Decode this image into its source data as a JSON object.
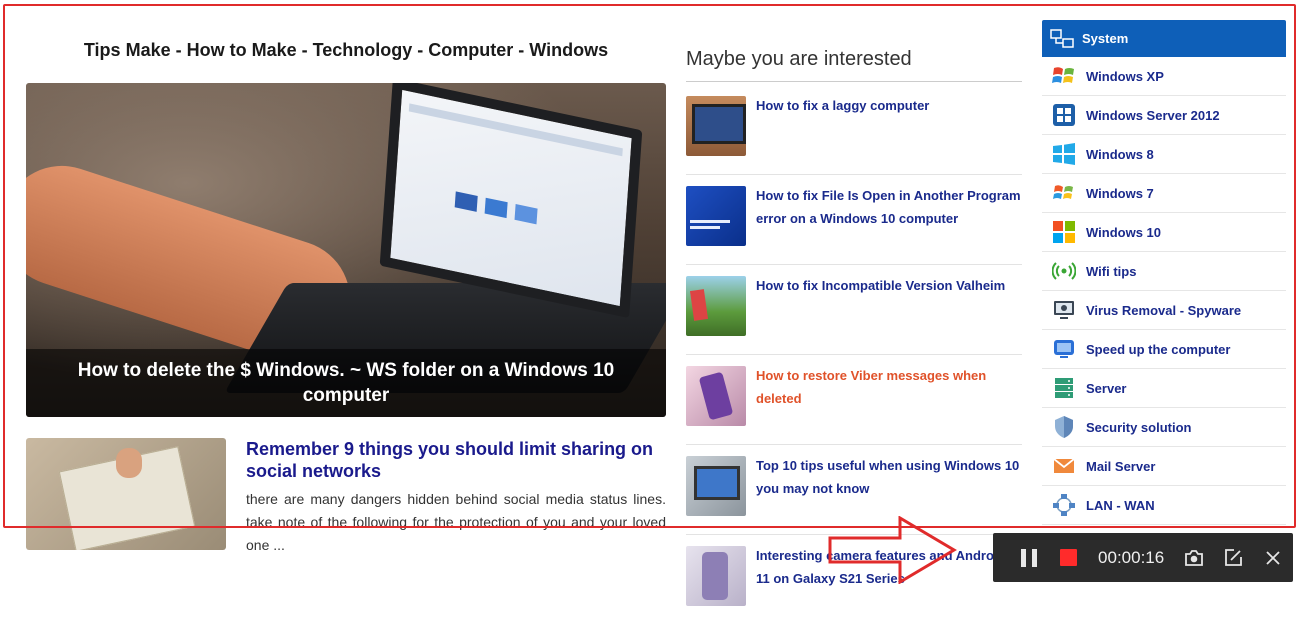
{
  "site_title": "Tips Make - How to Make - Technology - Computer - Windows",
  "hero": {
    "caption": "How to delete the $ Windows. ~ WS folder on a Windows 10 computer"
  },
  "article2": {
    "title": "Remember 9 things you should limit sharing on social networks",
    "description": "there are many dangers hidden behind social media status lines. take note of the following for the protection of you and your loved one ..."
  },
  "related": {
    "heading": "Maybe you are interested",
    "items": [
      {
        "title": "How to fix a laggy computer"
      },
      {
        "title": "How to fix File Is Open in Another Program error on a Windows 10 computer"
      },
      {
        "title": "How to fix Incompatible Version Valheim"
      },
      {
        "title": "How to restore Viber messages when deleted",
        "highlighted": true
      },
      {
        "title": "Top 10 tips useful when using Windows 10 you may not know"
      },
      {
        "title": "Interesting camera features and Android 11 on Galaxy S21 Series"
      }
    ]
  },
  "sidebar": {
    "heading": "System",
    "items": [
      {
        "label": "Windows XP",
        "icon": "windows-xp-icon"
      },
      {
        "label": "Windows Server 2012",
        "icon": "windows-server-icon"
      },
      {
        "label": "Windows 8",
        "icon": "windows-8-icon"
      },
      {
        "label": "Windows 7",
        "icon": "windows-7-icon"
      },
      {
        "label": "Windows 10",
        "icon": "windows-10-icon"
      },
      {
        "label": "Wifi tips",
        "icon": "wifi-icon"
      },
      {
        "label": "Virus Removal - Spyware",
        "icon": "virus-icon"
      },
      {
        "label": "Speed up the computer",
        "icon": "speed-icon"
      },
      {
        "label": "Server",
        "icon": "server-icon"
      },
      {
        "label": "Security solution",
        "icon": "shield-icon"
      },
      {
        "label": "Mail Server",
        "icon": "mail-icon"
      },
      {
        "label": "LAN - WAN",
        "icon": "network-icon"
      }
    ]
  },
  "recorder": {
    "time": "00:00:16"
  },
  "colors": {
    "accent": "#0e5fb8",
    "link": "#1a2a8c",
    "highlight": "#e0522a",
    "frame": "#e02b2b"
  }
}
